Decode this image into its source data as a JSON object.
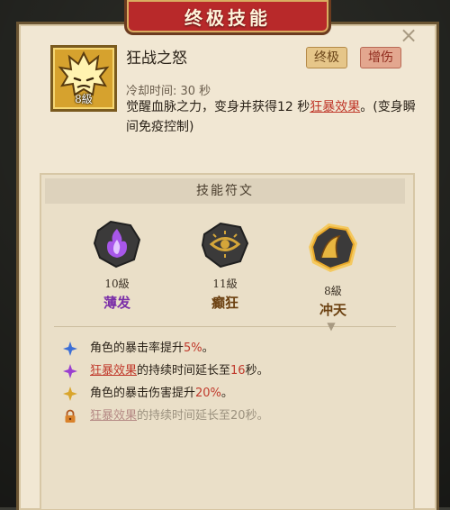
{
  "header": {
    "title": "终极技能"
  },
  "window": {
    "close_symbol": "×"
  },
  "skill": {
    "name": "狂战之怒",
    "level": "8級",
    "tags": [
      "终极",
      "增伤"
    ],
    "cooldown": "冷却时间: 30 秒",
    "description": {
      "part1": "觉醒血脉之力，变身并获得12 秒",
      "link": "狂暴效果",
      "part2": "。(变身瞬间免疫控制)"
    }
  },
  "runes": {
    "title": "技能符文",
    "items": [
      {
        "level": "10級",
        "name": "薄发",
        "color": "#7b2fa8",
        "icon": "purple-flame-icon"
      },
      {
        "level": "11級",
        "name": "癫狂",
        "color": "#6a3f0f",
        "icon": "golden-eye-icon"
      },
      {
        "level": "8級",
        "name": "冲天",
        "color": "#6a3f0f",
        "icon": "rising-wave-icon"
      }
    ]
  },
  "effects": [
    {
      "pre": "角色的暴击率提升",
      "hl": "5%",
      "post": "。",
      "icon": "blue-star-icon",
      "locked": false
    },
    {
      "link": "狂暴效果",
      "pre": "的持续时间延长至",
      "hl": "16",
      "post": "秒。",
      "icon": "purple-star-icon",
      "locked": false
    },
    {
      "pre": "角色的暴击伤害提升",
      "hl": "20%",
      "post": "。",
      "icon": "gold-star-icon",
      "locked": false
    },
    {
      "link": "狂暴效果",
      "pre": "的持续时间延长至",
      "hl": "20",
      "post": "秒。",
      "icon": "lock-icon",
      "locked": true
    }
  ],
  "colors": {
    "accent_red": "#c0392b",
    "ribbon_red": "#b8292a",
    "panel_bg": "#f1e7d3",
    "gold": "#d6a22e"
  }
}
